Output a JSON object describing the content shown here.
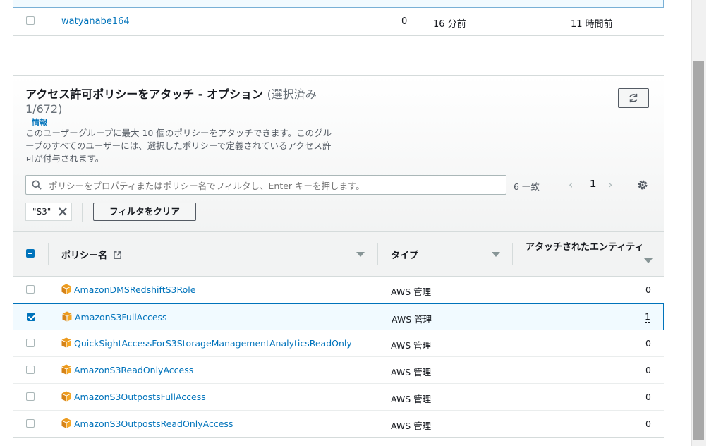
{
  "users_table": {
    "row": {
      "username": "watyanabe164",
      "groups": "0",
      "last_activity": "16 分前",
      "created": "11 時間前"
    }
  },
  "policy_panel": {
    "title": "アクセス許可ポリシーをアタッチ - オプション",
    "selection_count": "(選択済み 1/672)",
    "info_label": "情報",
    "description": "このユーザーグループに最大 10 個のポリシーをアタッチできます。このグループのすべてのユーザーには、選択したポリシーで定義されているアクセス許可が付与されます。",
    "search": {
      "placeholder": "ポリシーをプロパティまたはポリシー名でフィルタし、Enter キーを押します。"
    },
    "match_count": "6 一致",
    "pagination": {
      "current_page": "1"
    },
    "filter_token": "\"S3\"",
    "clear_filters_label": "フィルタをクリア",
    "columns": {
      "name": "ポリシー名",
      "type": "タイプ",
      "attached": "アタッチされたエンティティ"
    },
    "rows": [
      {
        "name": "AmazonDMSRedshiftS3Role",
        "type": "AWS 管理",
        "attached": "0",
        "selected": false
      },
      {
        "name": "AmazonS3FullAccess",
        "type": "AWS 管理",
        "attached": "1",
        "selected": true
      },
      {
        "name": "QuickSightAccessForS3StorageManagementAnalyticsReadOnly",
        "type": "AWS 管理",
        "attached": "0",
        "selected": false
      },
      {
        "name": "AmazonS3ReadOnlyAccess",
        "type": "AWS 管理",
        "attached": "0",
        "selected": false
      },
      {
        "name": "AmazonS3OutpostsFullAccess",
        "type": "AWS 管理",
        "attached": "0",
        "selected": false
      },
      {
        "name": "AmazonS3OutpostsReadOnlyAccess",
        "type": "AWS 管理",
        "attached": "0",
        "selected": false
      }
    ]
  },
  "colors": {
    "link": "#0073bb",
    "selected_bg": "#f1faff",
    "policy_icon": "#ec9b1f"
  },
  "icons": {
    "refresh": "refresh-icon",
    "search": "search-icon",
    "settings": "gear-icon",
    "external_link": "external-link-icon",
    "policy": "aws-policy-box-icon",
    "token_close": "close-icon"
  }
}
